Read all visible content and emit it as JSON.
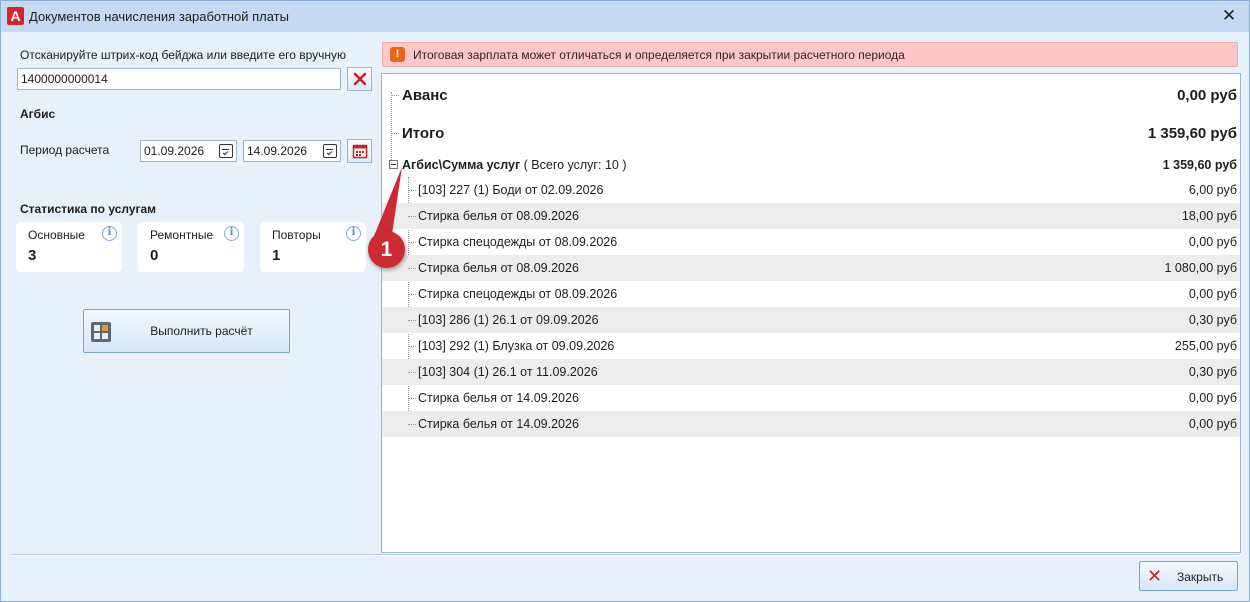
{
  "window": {
    "title": "Документов начисления заработной платы",
    "logo_letter": "A",
    "close_glyph": "✕"
  },
  "left": {
    "scan_label": "Отсканируйте штрих-код бейджа или введите его вручную",
    "barcode_value": "1400000000014",
    "employee_name": "Агбис",
    "period_label": "Период расчета",
    "date_from": "01.09.2026",
    "date_to": "14.09.2026",
    "stats_title": "Статистика по услугам",
    "stats": [
      {
        "title": "Основные",
        "value": "3"
      },
      {
        "title": "Ремонтные",
        "value": "0"
      },
      {
        "title": "Повторы",
        "value": "1"
      }
    ],
    "calc_button": "Выполнить расчёт",
    "info_glyph": "i"
  },
  "alert": {
    "icon": "!",
    "text": "Итоговая зарплата может отличаться и определяется при закрытии расчетного периода"
  },
  "tree": {
    "advance": {
      "name": "Аванс",
      "value": "0,00 руб"
    },
    "total": {
      "name": "Итого",
      "value": "1 359,60 руб"
    },
    "group": {
      "name": "Агбис\\Сумма услуг",
      "sub": " ( Всего услуг: 10 )",
      "value": "1 359,60 руб"
    },
    "items": [
      {
        "name": "[103] 227 (1) Боди от 02.09.2026",
        "value": "6,00 руб"
      },
      {
        "name": "Стирка белья от 08.09.2026",
        "value": "18,00 руб"
      },
      {
        "name": "Стирка спецодежды от 08.09.2026",
        "value": "0,00 руб"
      },
      {
        "name": "Стирка белья от 08.09.2026",
        "value": "1 080,00 руб"
      },
      {
        "name": "Стирка спецодежды от 08.09.2026",
        "value": "0,00 руб"
      },
      {
        "name": "[103] 286 (1) 26.1 от 09.09.2026",
        "value": "0,30 руб"
      },
      {
        "name": "[103] 292 (1) Блузка от 09.09.2026",
        "value": "255,00 руб"
      },
      {
        "name": "[103] 304 (1) 26.1 от 11.09.2026",
        "value": "0,30 руб"
      },
      {
        "name": "Стирка белья от 14.09.2026",
        "value": "0,00 руб"
      },
      {
        "name": "Стирка белья от 14.09.2026",
        "value": "0,00 руб"
      }
    ]
  },
  "callout": {
    "number": "1",
    "color": "#cc2b32"
  },
  "footer": {
    "close_button": "Закрыть",
    "close_icon": "✕"
  }
}
